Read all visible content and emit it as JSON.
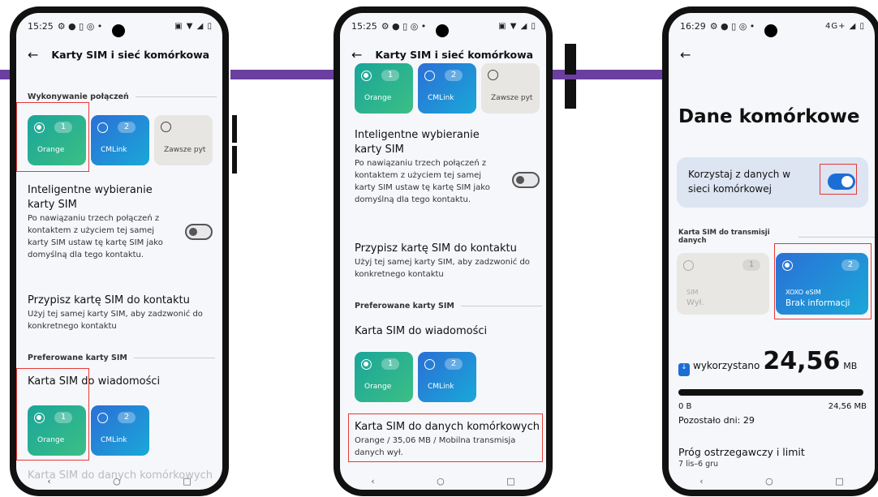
{
  "phone1": {
    "status_time": "15:25",
    "status_icons": "⚙ ● ▯ ◎ •",
    "status_right": "▣ ▼ ◢ ▯",
    "title": "Karty SIM i sieć komórkowa",
    "section_calls": "Wykonywanie połączeń",
    "sim1_num": "1",
    "sim1_name": "Orange",
    "sim2_num": "2",
    "sim2_name": "CMLink",
    "always_ask": "Zawsze pyt",
    "smart_title_1": "Inteligentne wybieranie",
    "smart_title_2": "karty SIM",
    "smart_sub": "Po nawiązaniu trzech połączeń z kontaktem z użyciem tej samej karty SIM ustaw tę kartę SIM jako domyślną dla tego kontaktu.",
    "assign_title": "Przypisz kartę SIM do kontaktu",
    "assign_sub": "Użyj tej samej karty SIM, aby zadzwonić do konkretnego kontaktu",
    "section_pref": "Preferowane karty SIM",
    "messages_title": "Karta SIM do wiadomości",
    "data_sim_title": "Karta SIM do danych komórkowych"
  },
  "phone2": {
    "status_time": "15:25",
    "status_icons": "⚙ ● ▯ ◎ •",
    "status_right": "▣ ▼ ◢ ▯",
    "title": "Karty SIM i sieć komórkowa",
    "sim1_num": "1",
    "sim1_name": "Orange",
    "sim2_num": "2",
    "sim2_name": "CMLink",
    "always_ask": "Zawsze pyt",
    "smart_title_1": "Inteligentne wybieranie",
    "smart_title_2": "karty SIM",
    "smart_sub": "Po nawiązaniu trzech połączeń z kontaktem z użyciem tej samej karty SIM ustaw tę kartę SIM jako domyślną dla tego kontaktu.",
    "assign_title": "Przypisz kartę SIM do kontaktu",
    "assign_sub": "Użyj tej samej karty SIM, aby zadzwonić do konkretnego kontaktu",
    "section_pref": "Preferowane karty SIM",
    "messages_title": "Karta SIM do wiadomości",
    "data_sim_title": "Karta SIM do danych komórkowych",
    "data_sim_sub": "Orange / 35,06 MB / Mobilna transmisja danych wył."
  },
  "phone3": {
    "status_time": "16:29",
    "status_icons": "⚙ ● ▯ ◎ •",
    "status_right": "4G+ ◢ ▯",
    "title": "Dane komórkowe",
    "use_data_label": "Korzystaj z danych w sieci komórkowej",
    "section_data_sim": "Karta SIM do transmisji danych",
    "sim1_num": "1",
    "sim1_name": "SIM",
    "sim1_state": "Wył.",
    "sim2_num": "2",
    "sim2_name": "XOXO eSIM",
    "sim2_state": "Brak informacji",
    "used_label": "wykorzystano",
    "used_value": "24,56",
    "used_unit": "MB",
    "range_min": "0 B",
    "range_max": "24,56 MB",
    "days_left": "Pozostało dni: 29",
    "warn_title": "Próg ostrzegawczy i limit",
    "warn_sub": "7 lis–6 gru"
  },
  "nav": {
    "back": "‹",
    "home": "○",
    "recent": "□"
  },
  "colors": {
    "accent_band": "#6b3fa0",
    "highlight": "#e53935",
    "sim_orange": "#1aa59a",
    "sim_cmlink": "#2b6fd6"
  }
}
